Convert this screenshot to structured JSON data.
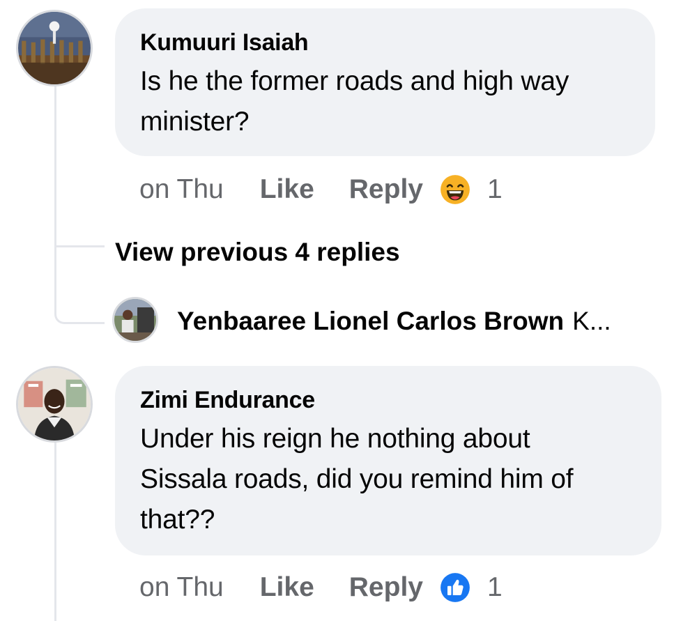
{
  "comments": [
    {
      "author": "Kumuuri Isaiah",
      "text_line1": "Is he the former roads and high way",
      "text_line2": "minister?",
      "time": "on Thu",
      "like_label": "Like",
      "reply_label": "Reply",
      "reaction_icon": "haha-emoji-icon",
      "reaction_count": "1"
    },
    {
      "author": "Zimi Endurance",
      "text_line1": "Under his reign he nothing about",
      "text_line2": "Sissala roads, did you remind him of",
      "text_line3": "that??",
      "time": "on Thu",
      "like_label": "Like",
      "reply_label": "Reply",
      "reaction_icon": "like-thumb-icon",
      "reaction_count": "1"
    }
  ],
  "replies": {
    "view_previous_label": "View previous 4 replies",
    "latest": {
      "author": "Yenbaaree Lionel Carlos Brown",
      "snippet": "K..."
    }
  },
  "colors": {
    "bubble": "#f0f2f5",
    "meta_text": "#65676b",
    "thread_line": "#e4e6eb",
    "like_blue": "#1877f2",
    "haha_yellow": "#f7b125"
  }
}
